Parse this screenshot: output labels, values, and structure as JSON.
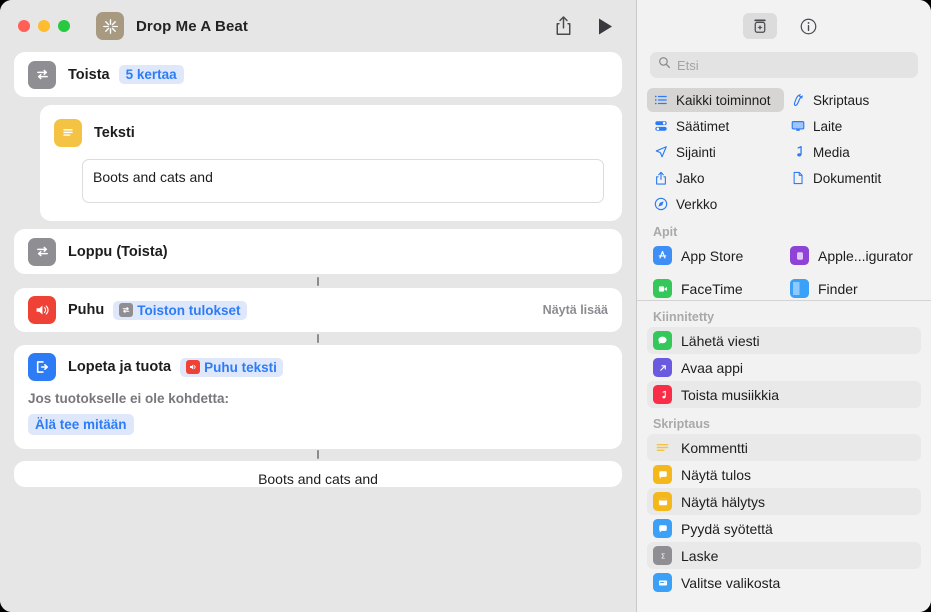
{
  "window": {
    "title": "Drop Me A Beat",
    "app_icon": "shortcuts-icon",
    "traffic_lights": [
      "close",
      "minimize",
      "zoom"
    ],
    "toolbar_buttons": [
      {
        "name": "share-button",
        "icon": "share-icon"
      },
      {
        "name": "play-button",
        "icon": "play-icon"
      }
    ]
  },
  "editor": {
    "actions": [
      {
        "id": "repeat",
        "icon": "repeat-icon",
        "icon_color": "#8e8e93",
        "label": "Toista",
        "token": "5 kertaa",
        "token_kind": "plain"
      },
      {
        "id": "text",
        "icon": "text-icon",
        "icon_color": "#f5c344",
        "label": "Teksti",
        "value": "Boots and cats and"
      },
      {
        "id": "repeat-end",
        "icon": "repeat-icon",
        "icon_color": "#8e8e93",
        "label": "Loppu (Toista)"
      },
      {
        "id": "speak",
        "icon": "speaker-icon",
        "icon_color": "#ef4136",
        "label": "Puhu",
        "token": "Toiston tulokset",
        "token_chip": "repeat-icon",
        "show_more": "Näytä lisää"
      },
      {
        "id": "stop-and-output",
        "icon": "exit-icon",
        "icon_color": "#2d7cf6",
        "label": "Lopeta ja tuota",
        "token": "Puhu teksti",
        "token_chip": "speaker-icon",
        "sub_label": "Jos tuotokselle ei ole kohdetta:",
        "sub_token": "Älä tee mitään"
      }
    ],
    "output_preview": "Boots and cats and"
  },
  "library": {
    "toolbar": [
      {
        "name": "action-library-button",
        "icon": "library-icon",
        "active": true
      },
      {
        "name": "info-button",
        "icon": "info-icon",
        "active": false
      }
    ],
    "search": {
      "placeholder": "Etsi",
      "value": "",
      "icon": "search-icon"
    },
    "categories": [
      {
        "label": "Kaikki toiminnot",
        "icon": "list-icon",
        "selected": true
      },
      {
        "label": "Skriptaus",
        "icon": "scripting-icon",
        "selected": false
      },
      {
        "label": "Säätimet",
        "icon": "controls-icon",
        "selected": false
      },
      {
        "label": "Laite",
        "icon": "device-icon",
        "selected": false
      },
      {
        "label": "Sijainti",
        "icon": "location-icon",
        "selected": false
      },
      {
        "label": "Media",
        "icon": "media-note-icon",
        "selected": false
      },
      {
        "label": "Jako",
        "icon": "share-icon",
        "selected": false
      },
      {
        "label": "Dokumentit",
        "icon": "document-icon",
        "selected": false
      },
      {
        "label": "Verkko",
        "icon": "web-compass-icon",
        "selected": false
      }
    ],
    "sections": [
      {
        "title": "Apit",
        "items": [
          {
            "label": "App Store",
            "icon": "app-store-icon",
            "color": "#2d7cf6"
          },
          {
            "label": "Apple...igurator",
            "icon": "apple-configurator-icon",
            "color": "#8d43d6"
          },
          {
            "label": "FaceTime",
            "icon": "facetime-icon",
            "color": "#34c759"
          },
          {
            "label": "Finder",
            "icon": "finder-icon",
            "color": "#3aa0f8"
          }
        ]
      },
      {
        "title": "Kiinnitetty",
        "items": [
          {
            "label": "Lähetä viesti",
            "icon": "messages-icon",
            "color": "#34c759",
            "alt": true
          },
          {
            "label": "Avaa appi",
            "icon": "open-app-icon",
            "color": "#6a5ae0",
            "alt": false
          },
          {
            "label": "Toista musiikkia",
            "icon": "music-icon",
            "color": "#fa2d48",
            "alt": true
          }
        ]
      },
      {
        "title": "Skriptaus",
        "items": [
          {
            "label": "Kommentti",
            "icon": "comment-icon",
            "color": "#f5c344",
            "alt": true
          },
          {
            "label": "Näytä tulos",
            "icon": "show-result-icon",
            "color": "#f5b81c",
            "alt": false
          },
          {
            "label": "Näytä hälytys",
            "icon": "show-alert-icon",
            "color": "#f5b81c",
            "alt": true
          },
          {
            "label": "Pyydä syötettä",
            "icon": "ask-input-icon",
            "color": "#3aa0f8",
            "alt": false
          },
          {
            "label": "Laske",
            "icon": "calculate-icon",
            "color": "#8e8e93",
            "alt": true
          },
          {
            "label": "Valitse valikosta",
            "icon": "choose-menu-icon",
            "color": "#3aa0f8",
            "alt": false
          }
        ]
      }
    ]
  },
  "colors": {
    "accent": "#2d7cf6",
    "token_bg": "#dfe8fb",
    "window_bg": "#e6e6e6",
    "library_bg": "#f2f2f2"
  }
}
